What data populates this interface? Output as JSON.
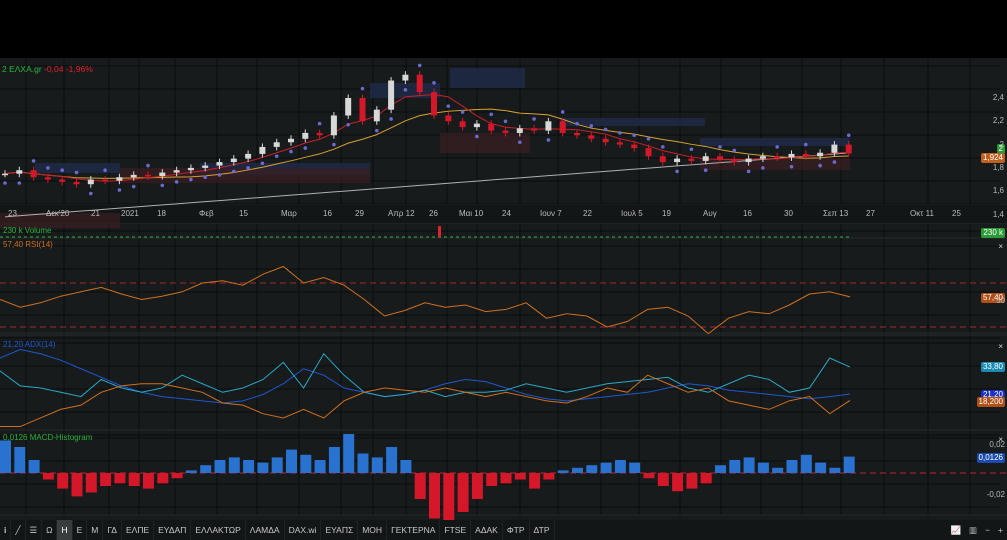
{
  "header": {
    "symbol": "2 ΕΛΧΑ.gr",
    "change": "-0,04",
    "change_pct": "-1,96%"
  },
  "colors": {
    "bg": "#171b1b",
    "up": "#d8d8d8",
    "down": "#d4182a",
    "ema_fast": "#c8202a",
    "ema_mid": "#d8a030",
    "sma_long": "#b0b0b0",
    "adx": "#1f58d0",
    "plus_di": "#2aa8c8",
    "minus_di": "#d07020",
    "macd_pos": "#2a72d0",
    "macd_neg": "#d4182a"
  },
  "price_axis": {
    "ticks": [
      "2,4",
      "2,2",
      "2",
      "1,8",
      "1,6",
      "1,4"
    ],
    "last_price": "1,924",
    "tag_green": "2"
  },
  "x_axis": {
    "labels": [
      "23",
      "Δεκ'20",
      "21",
      "2021",
      "18",
      "Φεβ",
      "15",
      "Μαρ",
      "16",
      "29",
      "Απρ 12",
      "26",
      "Μαι 10",
      "24",
      "Ιουν 7",
      "22",
      "Ιουλ 5",
      "19",
      "Αυγ",
      "16",
      "30",
      "Σεπ 13",
      "27",
      "Οκτ 11",
      "25"
    ]
  },
  "volume": {
    "label": "230 k Volume",
    "tag": "230 k"
  },
  "rsi": {
    "label": "57,40 RSI(14)",
    "tag": "57,40",
    "axis": "50",
    "close": "×"
  },
  "adx": {
    "label": "21,20 ADX(14)",
    "tag_plus": "33,80",
    "tag_adx": "21,20",
    "tag_minus": "18,200",
    "close": "×"
  },
  "macd": {
    "label": "0,0126 MACD-Histogram",
    "tag": "0,0126",
    "ticks": [
      "0,02",
      "-0,02"
    ],
    "close": "×"
  },
  "toolbar": {
    "tools": [
      "info",
      "pencil",
      "lines"
    ],
    "items": [
      "Ω",
      "Η",
      "Ε",
      "Μ",
      "ΓΔ",
      "ΕΛΠΕ",
      "ΕΥΔΑΠ",
      "ΕΛΛΑΚΤΩΡ",
      "ΛΑΜΔΑ",
      "DAX.wi",
      "ΕΥΑΠΣ",
      "ΜΟΗ",
      "ΓΕΚΤΕΡΝΑ",
      "FTSE",
      "ΑΔΑΚ",
      "ΦΤΡ",
      "ΔΤΡ"
    ],
    "active": "Η",
    "zoom_out": "−",
    "zoom_in": "+"
  },
  "chart_data": {
    "type": "line",
    "closes": [
      1.75,
      1.78,
      1.72,
      1.7,
      1.68,
      1.66,
      1.7,
      1.69,
      1.72,
      1.74,
      1.73,
      1.76,
      1.78,
      1.8,
      1.82,
      1.85,
      1.88,
      1.92,
      1.98,
      2.02,
      2.05,
      2.1,
      2.08,
      2.25,
      2.4,
      2.2,
      2.3,
      2.55,
      2.6,
      2.45,
      2.25,
      2.2,
      2.15,
      2.18,
      2.12,
      2.1,
      2.14,
      2.12,
      2.2,
      2.1,
      2.08,
      2.05,
      2.02,
      2.0,
      1.97,
      1.9,
      1.85,
      1.88,
      1.86,
      1.9,
      1.87,
      1.85,
      1.88,
      1.9,
      1.89,
      1.92,
      1.9,
      1.93,
      2.0,
      1.924
    ],
    "rsi": [
      55,
      48,
      52,
      58,
      62,
      66,
      60,
      55,
      58,
      62,
      70,
      72,
      68,
      78,
      85,
      70,
      75,
      68,
      55,
      40,
      45,
      52,
      48,
      50,
      44,
      46,
      52,
      38,
      42,
      40,
      30,
      35,
      46,
      48,
      40,
      24,
      38,
      44,
      42,
      50,
      60,
      62,
      57.4
    ],
    "adx": [
      38,
      42,
      40,
      37,
      33,
      29,
      25,
      22,
      20,
      19,
      18,
      17,
      18,
      21,
      26,
      33,
      30,
      24,
      22,
      20,
      21,
      23,
      26,
      28,
      27,
      24,
      21,
      19,
      18,
      19,
      20,
      21,
      22,
      24,
      26,
      25,
      23,
      22,
      21,
      20,
      19,
      20,
      21.2
    ],
    "plus_di": [
      32,
      25,
      24,
      22,
      20,
      28,
      24,
      22,
      24,
      30,
      26,
      22,
      24,
      28,
      36,
      24,
      40,
      30,
      22,
      20,
      21,
      23,
      20,
      22,
      22,
      23,
      26,
      24,
      22,
      24,
      26,
      27,
      28,
      29,
      24,
      22,
      26,
      30,
      28,
      22,
      24,
      38,
      33.8
    ],
    "minus_di": [
      6,
      6,
      10,
      14,
      16,
      22,
      25,
      26,
      26,
      24,
      22,
      17,
      16,
      12,
      10,
      14,
      10,
      18,
      22,
      24,
      23,
      22,
      24,
      22,
      20,
      22,
      20,
      18,
      17,
      20,
      24,
      22,
      30,
      26,
      22,
      24,
      18,
      16,
      14,
      18,
      20,
      12,
      18.2
    ],
    "macd_hist": [
      0.025,
      0.02,
      0.01,
      -0.005,
      -0.012,
      -0.018,
      -0.015,
      -0.01,
      -0.008,
      -0.01,
      -0.012,
      -0.008,
      -0.004,
      0.002,
      0.006,
      0.01,
      0.012,
      0.01,
      0.008,
      0.012,
      0.018,
      0.014,
      0.01,
      0.02,
      0.03,
      0.015,
      0.012,
      0.02,
      0.01,
      -0.02,
      -0.035,
      -0.04,
      -0.03,
      -0.02,
      -0.01,
      -0.008,
      -0.005,
      -0.012,
      -0.005,
      0.002,
      0.004,
      0.006,
      0.008,
      0.01,
      0.008,
      -0.004,
      -0.01,
      -0.014,
      -0.012,
      -0.008,
      0.006,
      0.01,
      0.012,
      0.008,
      0.004,
      0.01,
      0.014,
      0.008,
      0.004,
      0.0126
    ],
    "ylim_price": [
      1.3,
      2.7
    ],
    "rsi_levels": [
      70,
      30
    ],
    "macd_zero": 0
  }
}
